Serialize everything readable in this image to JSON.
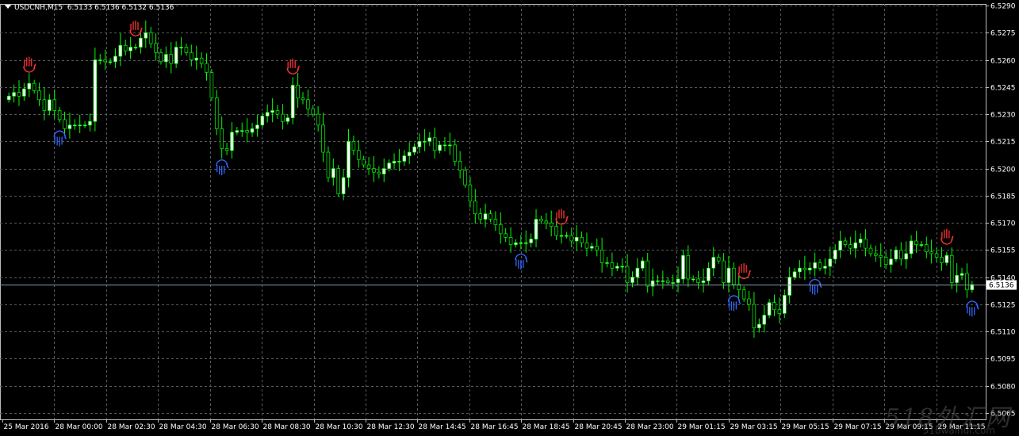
{
  "header": {
    "symbol": "USDCNH,M15",
    "ohlc": "6.5133 6.5136 6.5132 6.5136"
  },
  "current_price_label": "6.5136",
  "watermark": {
    "logo_text": "518外汇网",
    "url_text": "518waihui.com"
  },
  "colors": {
    "background": "#000000",
    "grid": "#5a5a5a",
    "bull_candle": "#ffffff",
    "wick": "#00ff00",
    "bear_candle": "#000000",
    "axis_text": "#ffffff",
    "price_line": "#8899aa",
    "up_fractal": "#ff3333",
    "down_fractal": "#3366ff"
  },
  "chart_data": {
    "type": "candlestick",
    "ylim": [
      6.5065,
      6.529
    ],
    "y_ticks": [
      "6.5290",
      "6.5275",
      "6.5260",
      "6.5245",
      "6.5230",
      "6.5215",
      "6.5200",
      "6.5185",
      "6.5170",
      "6.5155",
      "6.5140",
      "6.5125",
      "6.5110",
      "6.5095",
      "6.5080",
      "6.5065"
    ],
    "x_ticks": [
      "25 Mar 2016",
      "28 Mar 00:00",
      "28 Mar 02:30",
      "28 Mar 04:30",
      "28 Mar 06:30",
      "28 Mar 08:30",
      "28 Mar 10:30",
      "28 Mar 12:30",
      "28 Mar 14:45",
      "28 Mar 16:45",
      "28 Mar 18:45",
      "28 Mar 20:45",
      "28 Mar 23:00",
      "29 Mar 01:15",
      "29 Mar 03:15",
      "29 Mar 05:15",
      "29 Mar 07:15",
      "29 Mar 09:15",
      "29 Mar 11:15"
    ],
    "current_price": 6.5136,
    "candle_count": 189,
    "closes": [
      6.524,
      6.5242,
      6.524,
      6.5244,
      6.5247,
      6.5243,
      6.5238,
      6.5232,
      6.5238,
      6.5232,
      6.5227,
      6.5222,
      6.5224,
      6.5224,
      6.5224,
      6.5224,
      6.5226,
      6.526,
      6.526,
      6.5259,
      6.5259,
      6.5262,
      6.5268,
      6.5265,
      6.5267,
      6.5267,
      6.5272,
      6.5275,
      6.5269,
      6.5264,
      6.5259,
      6.5263,
      6.5258,
      6.5267,
      6.5267,
      6.5264,
      6.526,
      6.5261,
      6.5258,
      6.5253,
      6.5239,
      6.5222,
      6.5211,
      6.521,
      6.522,
      6.5221,
      6.5221,
      6.522,
      6.5222,
      6.5224,
      6.5229,
      6.5231,
      6.5232,
      6.523,
      6.5226,
      6.5228,
      6.5246,
      6.5239,
      6.5238,
      6.5233,
      6.523,
      6.5224,
      6.5209,
      6.5195,
      6.52,
      6.5186,
      6.5195,
      6.5215,
      6.521,
      6.5205,
      6.5202,
      6.52,
      6.5198,
      6.5197,
      6.52,
      6.5203,
      6.5204,
      6.5204,
      6.5207,
      6.5209,
      6.5212,
      6.5215,
      6.5215,
      6.5217,
      6.521,
      6.5213,
      6.5213,
      6.5213,
      6.5204,
      6.5199,
      6.5191,
      6.5182,
      6.5175,
      6.5172,
      6.5175,
      6.5172,
      6.5169,
      6.5164,
      6.5162,
      6.5158,
      6.5159,
      6.5159,
      6.5159,
      6.5161,
      6.5172,
      6.5171,
      6.517,
      6.5168,
      6.5163,
      6.5163,
      6.5163,
      6.516,
      6.5162,
      6.5159,
      6.5156,
      6.5157,
      6.5155,
      6.5148,
      6.5148,
      6.5145,
      6.5146,
      6.5146,
      6.5137,
      6.514,
      6.5145,
      6.5149,
      6.5135,
      6.5138,
      6.5138,
      6.5138,
      6.5137,
      6.5137,
      6.5139,
      6.5152,
      6.5139,
      6.5139,
      6.5137,
      6.5138,
      6.5145,
      6.5151,
      6.5149,
      6.5137,
      6.5145,
      6.5136,
      6.5133,
      6.5128,
      6.5125,
      6.5112,
      6.5114,
      6.5119,
      6.5126,
      6.5122,
      6.512,
      6.513,
      6.514,
      6.5143,
      6.5145,
      6.5144,
      6.5145,
      6.5148,
      6.5145,
      6.5146,
      6.515,
      6.5155,
      6.516,
      6.5158,
      6.5156,
      6.5159,
      6.5161,
      6.5156,
      6.5153,
      6.5152,
      6.5151,
      6.5147,
      6.515,
      6.5155,
      6.515,
      6.5153,
      6.516,
      6.5158,
      6.5158,
      6.5154,
      6.5153,
      6.5151,
      6.5148,
      6.5152,
      6.5137,
      6.5141,
      6.5142,
      6.5133,
      6.5136
    ],
    "up_fractal_indices": [
      4,
      25,
      56,
      109,
      145,
      185
    ],
    "down_fractal_indices": [
      10,
      42,
      101,
      143,
      159,
      198
    ]
  }
}
